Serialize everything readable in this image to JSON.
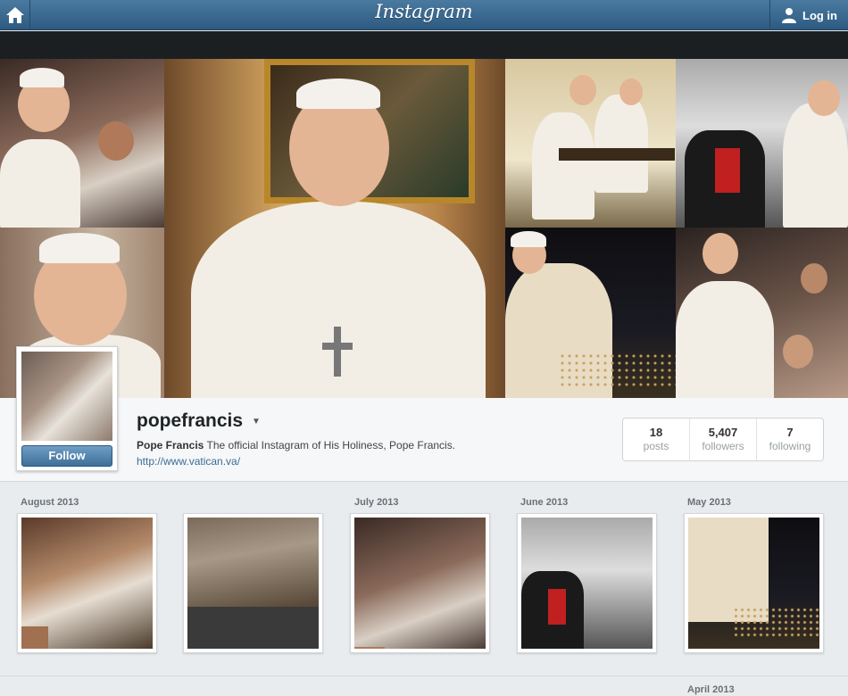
{
  "header": {
    "logo": "Instagram",
    "login_label": "Log in",
    "home_icon": "home-icon",
    "user_icon": "user-icon"
  },
  "profile": {
    "username": "popefrancis",
    "full_name": "Pope Francis",
    "bio": "The official Instagram of His Holiness, Pope Francis.",
    "website": "http://www.vatican.va/",
    "follow_label": "Follow",
    "stats": [
      {
        "value": "18",
        "label": "posts"
      },
      {
        "value": "5,407",
        "label": "followers"
      },
      {
        "value": "7",
        "label": "following"
      }
    ]
  },
  "feed": {
    "months": [
      "August 2013",
      "July 2013",
      "June 2013",
      "May 2013",
      "April 2013"
    ]
  },
  "colors": {
    "header_blue": "#3b6a91",
    "link_blue": "#3a6d98",
    "follow_button": "#4d7ca5"
  }
}
